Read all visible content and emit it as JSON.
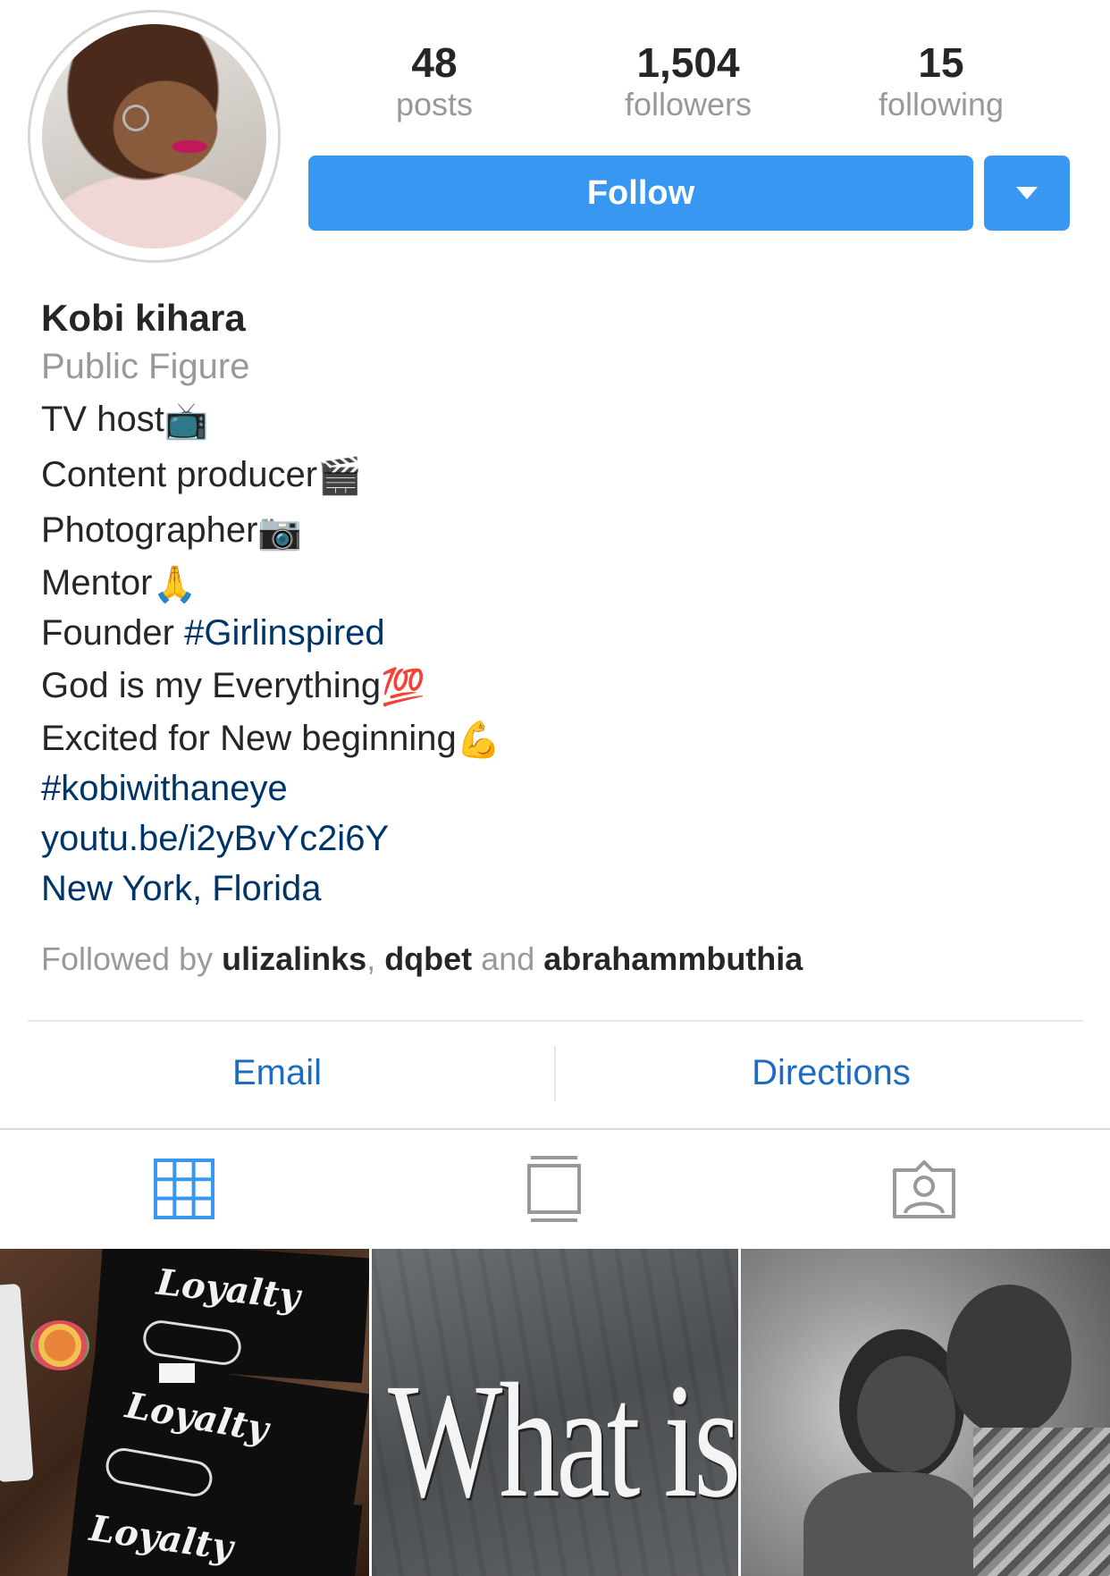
{
  "profile": {
    "avatar_alt": "profile-photo",
    "stats": [
      {
        "value": "48",
        "label": "posts"
      },
      {
        "value": "1,504",
        "label": "followers"
      },
      {
        "value": "15",
        "label": "following"
      }
    ],
    "follow_label": "Follow"
  },
  "bio": {
    "name": "Kobi kihara",
    "category": "Public Figure",
    "lines": [
      {
        "text": "TV host",
        "emoji": "📺"
      },
      {
        "text": "Content producer",
        "emoji": "🎬"
      },
      {
        "text": "Photographer",
        "emoji": "📷"
      },
      {
        "text": "Mentor",
        "emoji": "🙏"
      }
    ],
    "founder_prefix": "Founder ",
    "founder_tag": "#Girlinspired",
    "god_line": "God is my Everything",
    "god_emoji": "💯",
    "excited_line": "Excited for New beginning",
    "excited_emoji": "💪",
    "hashtag": "#kobiwithaneye",
    "link": "youtu.be/i2yBvYc2i6Y",
    "location": "New York, Florida"
  },
  "followed_by": {
    "prefix": "Followed by ",
    "user1": "ulizalinks",
    "comma": ", ",
    "user2": "dqbet",
    "and": " and ",
    "user3": "abrahammbuthia"
  },
  "contact": {
    "email_label": "Email",
    "directions_label": "Directions"
  },
  "tabs": [
    "grid-view-icon",
    "feed-view-icon",
    "tagged-photos-icon"
  ],
  "grid": {
    "post1_text": [
      "Loyalty",
      "Loyalty",
      "Loyalty"
    ],
    "post2_text": "What is It"
  },
  "colors": {
    "accent": "#3897f0",
    "link": "#003569",
    "contact_link": "#1e6cbf",
    "muted": "#999999"
  }
}
